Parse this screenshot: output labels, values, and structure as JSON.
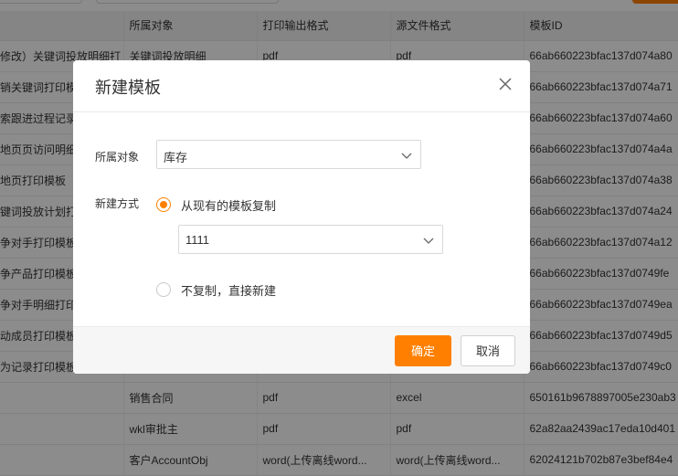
{
  "table": {
    "headers": [
      "",
      "所属对象",
      "打印输出格式",
      "源文件格式",
      "模板ID"
    ],
    "rows": [
      [
        "修改）关键词投放明细打",
        "关键词投放明细",
        "pdf",
        "pdf",
        "66ab660223bfac137d074a80"
      ],
      [
        "销关键词打印模",
        "",
        "",
        "",
        "66ab660223bfac137d074a71"
      ],
      [
        "索跟进过程记录",
        "",
        "",
        "",
        "66ab660223bfac137d074a60"
      ],
      [
        "地页页访问明细",
        "",
        "",
        "",
        "66ab660223bfac137d074a4a"
      ],
      [
        "地页打印模板",
        "",
        "",
        "",
        "66ab660223bfac137d074a38"
      ],
      [
        "键词投放计划打",
        "",
        "",
        "",
        "66ab660223bfac137d074a24"
      ],
      [
        "争对手打印模板",
        "",
        "",
        "",
        "66ab660223bfac137d074a12"
      ],
      [
        "争产品打印模板",
        "",
        "",
        "",
        "66ab660223bfac137d0749fe"
      ],
      [
        "争对手明细打印",
        "",
        "",
        "",
        "66ab660223bfac137d0749ea"
      ],
      [
        "动成员打印模板",
        "",
        "",
        "",
        "66ab660223bfac137d0749d5"
      ],
      [
        "为记录打印模板",
        "",
        "",
        "",
        "66ab660223bfac137d0749c0"
      ],
      [
        "",
        "销售合同",
        "pdf",
        "excel",
        "650161b9678897005e230ab3"
      ],
      [
        "",
        "wkl审批主",
        "pdf",
        "pdf",
        "62a82aa2439ac17eda10d401"
      ],
      [
        "",
        "客户AccountObj",
        "word(上传离线word...",
        "word(上传离线word...",
        "62024121b702b87e3bef84e4"
      ]
    ]
  },
  "modal": {
    "title": "新建模板",
    "object_label": "所属对象",
    "object_value": "库存",
    "method_label": "新建方式",
    "option_copy": "从现有的模板复制",
    "template_value": "1111",
    "option_new": "不复制，直接新建",
    "confirm_label": "确定",
    "cancel_label": "取消"
  },
  "colors": {
    "accent": "#ff8000"
  },
  "icons": {
    "close": "close-icon",
    "dropdown": "chevron-down-icon"
  }
}
